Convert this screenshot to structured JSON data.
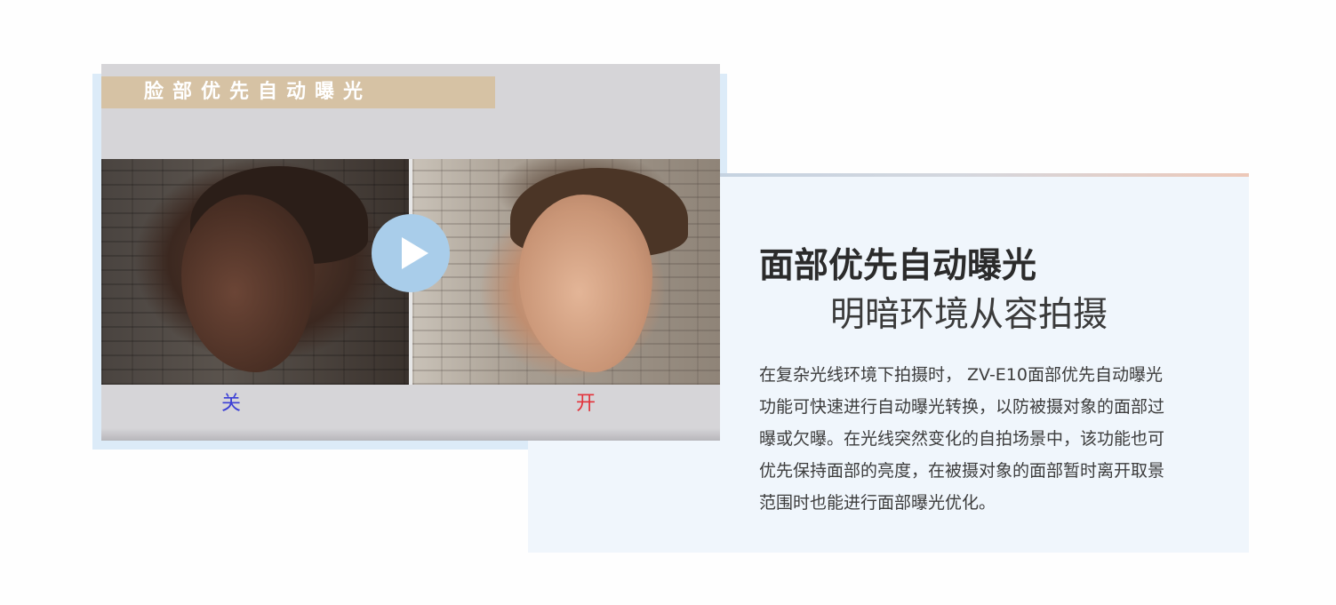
{
  "video": {
    "overlay_title": "脸部优先自动曝光",
    "label_off": "关",
    "label_on": "开",
    "play_icon": "play-icon",
    "play_button_color": "#a9cdea",
    "label_off_color": "#3b3fd6",
    "label_on_color": "#e2333b"
  },
  "feature": {
    "title": "面部优先自动曝光",
    "subtitle": "明暗环境从容拍摄",
    "description_lines": [
      "在复杂光线环境下拍摄时， ZV-E10面部优先自动曝光",
      "功能可快速进行自动曝光转换，以防被摄对象的面部过",
      "曝或欠曝。在光线突然变化的自拍场景中，该功能也可",
      "优先保持面部的亮度，在被摄对象的面部暂时离开取景",
      "范围时也能进行面部曝光优化。"
    ]
  },
  "colors": {
    "panel_background": "#f0f6fc",
    "video_backdrop": "#dcebf8",
    "title_band": "#d6c2a4"
  }
}
